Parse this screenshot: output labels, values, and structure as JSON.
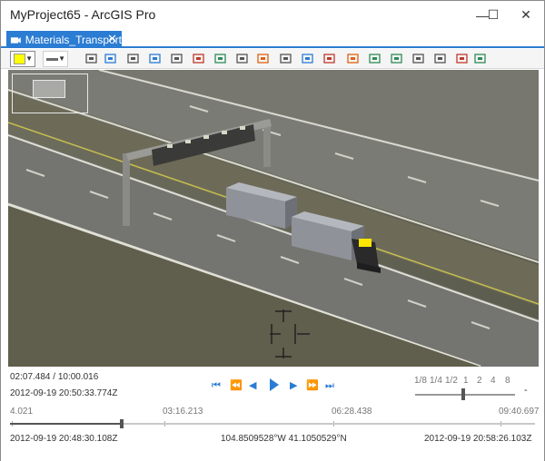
{
  "window": {
    "title": "MyProject65 - ArcGIS Pro",
    "minimize_glyph": "—",
    "maximize_glyph": "☐",
    "close_glyph": "✕"
  },
  "tab": {
    "label": "Materials_Transport",
    "close_glyph": "✕",
    "icon": "video-layer-icon"
  },
  "toolbar": {
    "fill_color": "#ffff00",
    "dropdown_glyph": "▼",
    "tools": [
      "zoom-to-video-icon",
      "pan-to-frame-icon",
      "map-follow-icon",
      "north-up-icon",
      "capture-frame-icon",
      "delete-frame-icon",
      "export-frame-icon",
      "bookmark-icon",
      "marker-icon",
      "add-marker-icon",
      "add-point-icon",
      "add-line-icon",
      "add-polygon-icon",
      "image-export-icon",
      "frame-stack-icon",
      "presentation-icon",
      "view-video-icon",
      "export-clip-icon",
      "copy-icon"
    ]
  },
  "controls": {
    "current_elapsed": "02:07.484 / 10:00.016",
    "current_datetime": "2012-09-19 20:50:33.774Z",
    "speed_labels": [
      "1/8",
      "1/4",
      "1/2",
      "1",
      "2",
      "4",
      "8"
    ],
    "speed_value": 1,
    "speed_minus": "-",
    "timeline_ticks": [
      "4.021",
      "03:16.213",
      "06:28.438",
      "09:40.697"
    ],
    "progress_fraction": 0.212,
    "start_datetime": "2012-09-19 20:48:30.108Z",
    "coordinates": "104.8509528°W 41.1050529°N",
    "end_datetime": "2012-09-19 20:58:26.103Z",
    "buttons": {
      "skip_start": "⏮",
      "rewind": "⏪",
      "step_back": "◀",
      "step_forward": "▶",
      "fast_forward": "⏩",
      "skip_end": "⏭"
    }
  },
  "colors": {
    "accent": "#2b7cd3",
    "truck_highlight": "#ffe600"
  }
}
